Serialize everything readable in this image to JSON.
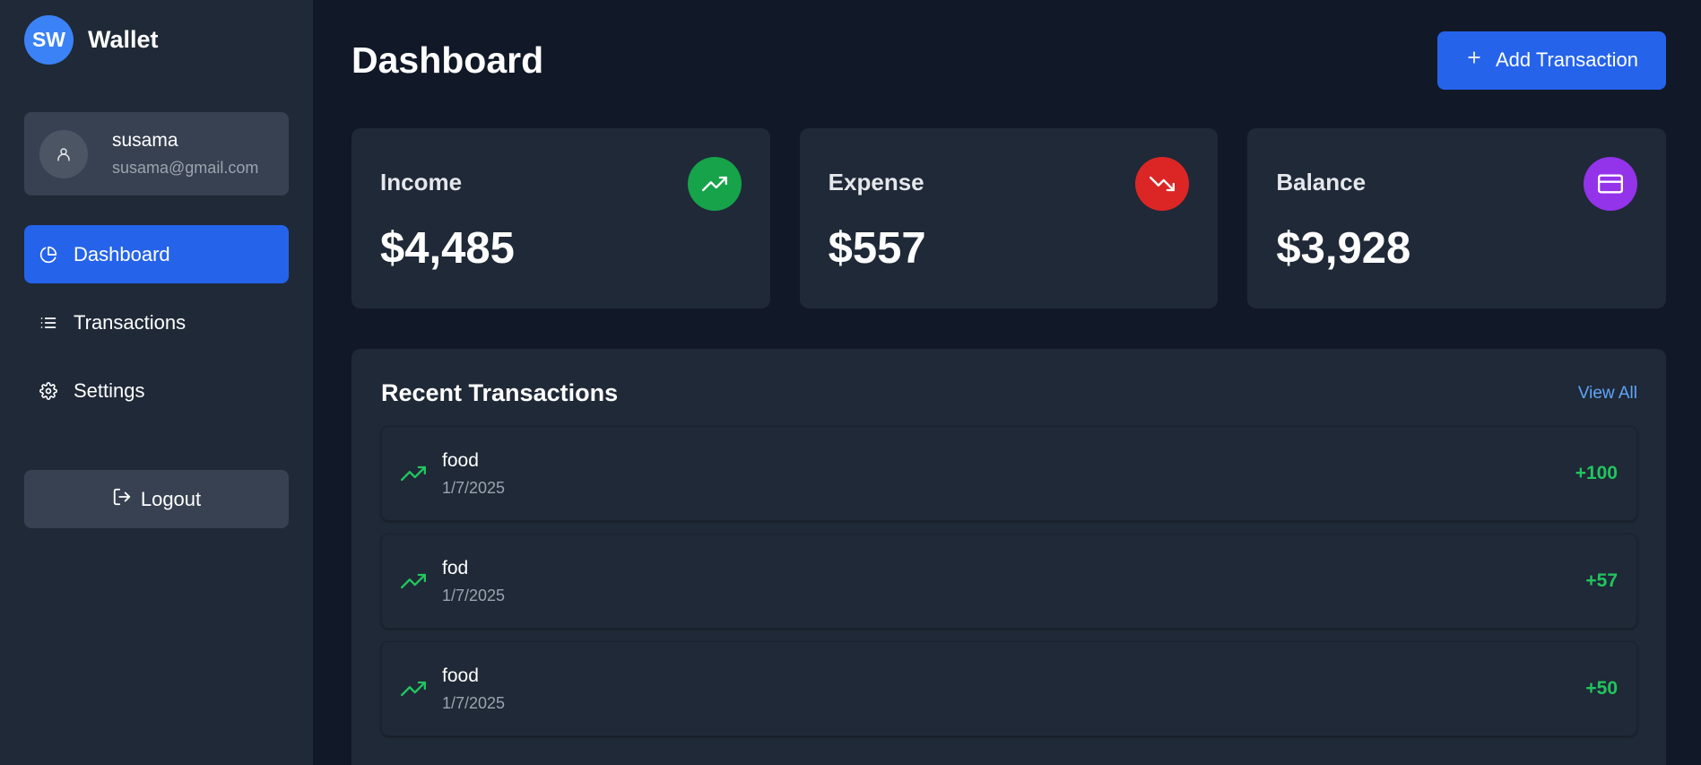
{
  "brand": {
    "initials": "SW",
    "name": "Wallet"
  },
  "user": {
    "name": "susama",
    "email": "susama@gmail.com"
  },
  "nav": [
    {
      "label": "Dashboard",
      "icon": "pie-chart-icon",
      "active": true
    },
    {
      "label": "Transactions",
      "icon": "list-icon",
      "active": false
    },
    {
      "label": "Settings",
      "icon": "gear-icon",
      "active": false
    }
  ],
  "logout_label": "Logout",
  "header": {
    "title": "Dashboard",
    "add_button_label": "Add Transaction"
  },
  "stats": [
    {
      "title": "Income",
      "value": "$4,485",
      "icon": "trending-up-icon",
      "color": "#16a34a"
    },
    {
      "title": "Expense",
      "value": "$557",
      "icon": "trending-down-icon",
      "color": "#dc2626"
    },
    {
      "title": "Balance",
      "value": "$3,928",
      "icon": "credit-card-icon",
      "color": "#9333ea"
    }
  ],
  "recent": {
    "title": "Recent Transactions",
    "view_all_label": "View All",
    "items": [
      {
        "name": "food",
        "date": "1/7/2025",
        "amount": "+100"
      },
      {
        "name": "fod",
        "date": "1/7/2025",
        "amount": "+57"
      },
      {
        "name": "food",
        "date": "1/7/2025",
        "amount": "+50"
      }
    ]
  },
  "colors": {
    "accent": "#2563eb",
    "income": "#22c55e",
    "link": "#60a5fa"
  }
}
